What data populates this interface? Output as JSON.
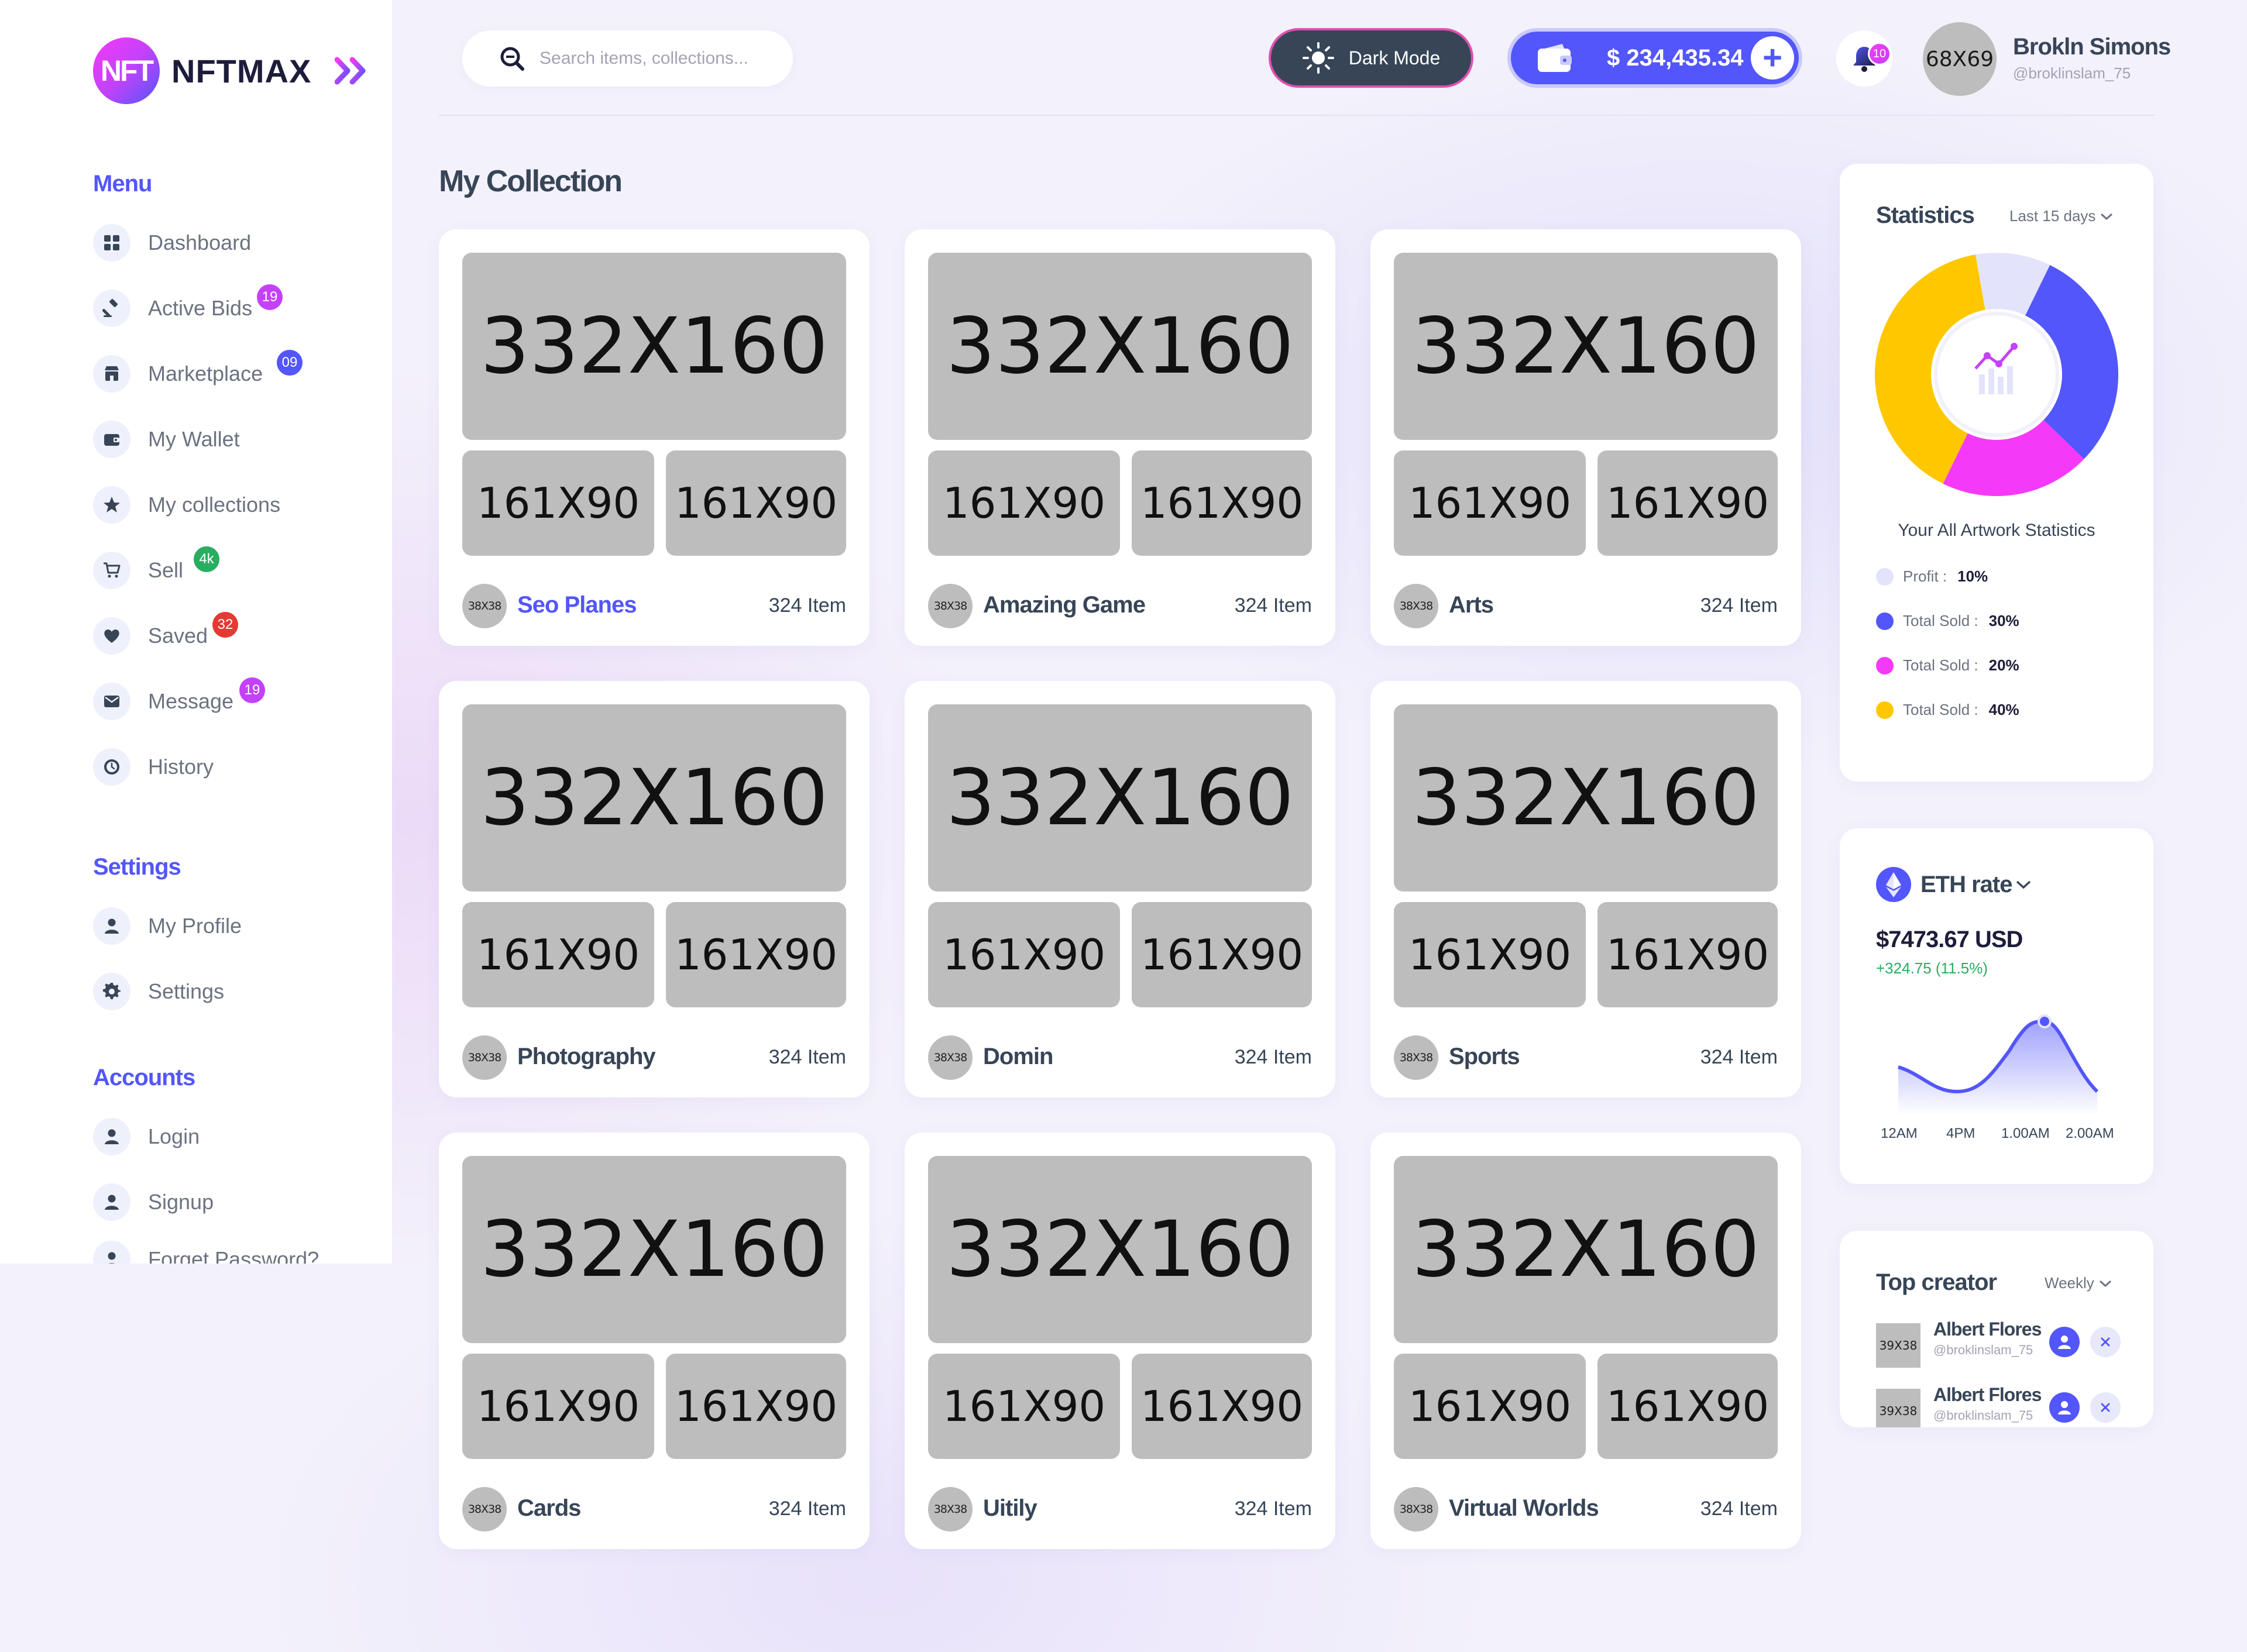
{
  "brand": {
    "logo_mark": "NFT",
    "name": "NFTMAX"
  },
  "sidebar": {
    "menu_title": "Menu",
    "menu_items": [
      {
        "label": "Dashboard",
        "icon": "dashboard-icon",
        "badge": ""
      },
      {
        "label": "Active Bids",
        "icon": "gavel-icon",
        "badge": "19"
      },
      {
        "label": "Marketplace",
        "icon": "store-icon",
        "badge": "09"
      },
      {
        "label": "My Wallet",
        "icon": "wallet-icon",
        "badge": ""
      },
      {
        "label": "My collections",
        "icon": "star-icon",
        "badge": ""
      },
      {
        "label": "Sell",
        "icon": "cart-icon",
        "badge": "4k"
      },
      {
        "label": "Saved",
        "icon": "heart-icon",
        "badge": "32"
      },
      {
        "label": "Message",
        "icon": "mail-icon",
        "badge": "19"
      },
      {
        "label": "History",
        "icon": "clock-icon",
        "badge": ""
      }
    ],
    "settings_title": "Settings",
    "settings_items": [
      {
        "label": "My Profile",
        "icon": "user-icon"
      },
      {
        "label": "Settings",
        "icon": "gear-icon"
      }
    ],
    "accounts_title": "Accounts",
    "accounts_items": [
      {
        "label": "Login",
        "icon": "user-icon"
      },
      {
        "label": "Signup",
        "icon": "user-icon"
      },
      {
        "label": "Forget Password?",
        "icon": "user-icon"
      }
    ]
  },
  "header": {
    "search_placeholder": "Search items, collections...",
    "dark_mode_label": "Dark Mode",
    "wallet_balance": "$ 234,435.34",
    "notification_count": "10",
    "avatar_placeholder": "68X69",
    "user_name": "Brokln Simons",
    "user_handle": "@broklinslam_75"
  },
  "collection": {
    "title": "My Collection",
    "placeholders": {
      "main": "332X160",
      "thumb": "161X90",
      "avatar": "38X38"
    },
    "cards": [
      {
        "name": "Seo Planes",
        "count": "324 Item",
        "active": true
      },
      {
        "name": "Amazing Game",
        "count": "324 Item",
        "active": false
      },
      {
        "name": "Arts",
        "count": "324 Item",
        "active": false
      },
      {
        "name": "Photography",
        "count": "324 Item",
        "active": false
      },
      {
        "name": "Domin",
        "count": "324 Item",
        "active": false
      },
      {
        "name": "Sports",
        "count": "324 Item",
        "active": false
      },
      {
        "name": "Cards",
        "count": "324 Item",
        "active": false
      },
      {
        "name": "Uitily",
        "count": "324 Item",
        "active": false
      },
      {
        "name": "Virtual Worlds",
        "count": "324 Item",
        "active": false
      }
    ]
  },
  "statistics": {
    "title": "Statistics",
    "period": "Last 15 days",
    "caption": "Your All Artwork Statistics",
    "items": [
      {
        "label": "Profit :",
        "value": "10%",
        "color": "#e3e3fb",
        "percent": 10
      },
      {
        "label": "Total Sold :",
        "value": "30%",
        "color": "#5356fb",
        "percent": 30
      },
      {
        "label": "Total Sold :",
        "value": "20%",
        "color": "#f539f8",
        "percent": 20
      },
      {
        "label": "Total Sold :",
        "value": "40%",
        "color": "#ffc700",
        "percent": 40
      }
    ]
  },
  "eth": {
    "title": "ETH rate",
    "price": "$7473.67 USD",
    "change": "+324.75 (11.5%)",
    "x_labels": [
      "12AM",
      "4PM",
      "1.00AM",
      "2.00AM"
    ]
  },
  "top_creator": {
    "title": "Top creator",
    "period": "Weekly",
    "avatar_placeholder": "39X38",
    "creators": [
      {
        "name": "Albert Flores",
        "handle": "@broklinslam_75"
      },
      {
        "name": "Albert Flores",
        "handle": "@broklinslam_75"
      }
    ]
  },
  "colors": {
    "accent": "#5356fb",
    "pink": "#f539f8",
    "yellow": "#ffc700",
    "text": "#374557",
    "green": "#27ae60"
  }
}
